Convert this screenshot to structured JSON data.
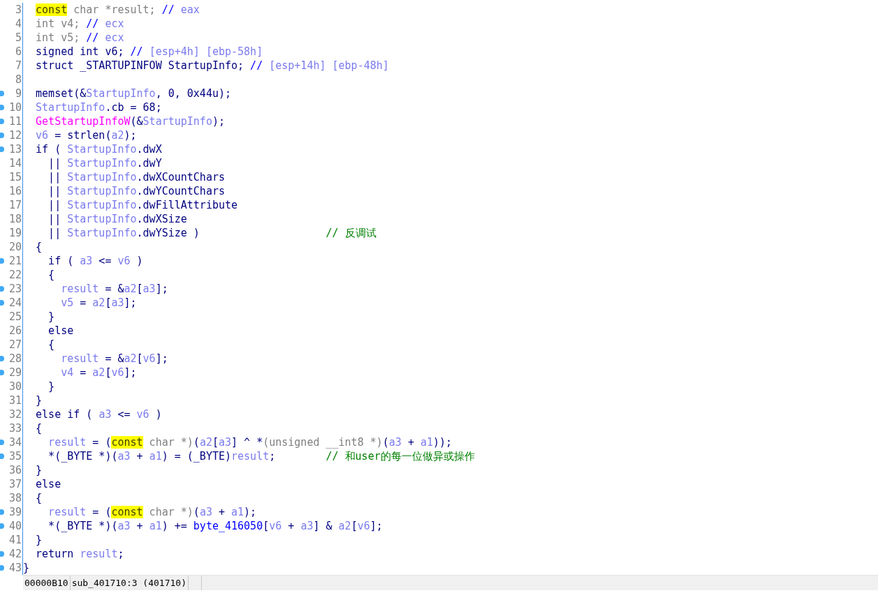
{
  "code_lines": [
    {
      "number": "3",
      "dot": false,
      "tokens": [
        {
          "kind": "highlight",
          "text": "  const"
        },
        {
          "kind": "type",
          "text": " char *result; "
        },
        {
          "kind": "ident",
          "text": "// "
        },
        {
          "kind": "var",
          "text": "eax"
        }
      ]
    },
    {
      "number": "4",
      "dot": false,
      "tokens": [
        {
          "kind": "type",
          "text": "  int v4; "
        },
        {
          "kind": "ident",
          "text": "// "
        },
        {
          "kind": "var",
          "text": "ecx"
        }
      ]
    },
    {
      "number": "5",
      "dot": false,
      "tokens": [
        {
          "kind": "type",
          "text": "  int v5; "
        },
        {
          "kind": "ident",
          "text": "// "
        },
        {
          "kind": "var",
          "text": "ecx"
        }
      ]
    },
    {
      "number": "6",
      "dot": false,
      "tokens": [
        {
          "kind": "plain",
          "text": "  signed int v6; "
        },
        {
          "kind": "ident",
          "text": "// "
        },
        {
          "kind": "var",
          "text": "[esp+4h] [ebp-58h]"
        }
      ]
    },
    {
      "number": "7",
      "dot": false,
      "tokens": [
        {
          "kind": "plain",
          "text": "  struct _STARTUPINFOW StartupInfo; "
        },
        {
          "kind": "ident",
          "text": "// "
        },
        {
          "kind": "var",
          "text": "[esp+14h] [ebp-48h]"
        }
      ]
    },
    {
      "number": "8",
      "dot": false
    },
    {
      "number": "9",
      "dot": true,
      "tokens": [
        {
          "kind": "plain",
          "text": "  memset(&"
        },
        {
          "kind": "var",
          "text": "StartupInfo"
        },
        {
          "kind": "plain",
          "text": ", 0, 0x44u);"
        }
      ]
    },
    {
      "number": "10",
      "dot": true,
      "tokens": [
        {
          "kind": "var",
          "text": "  StartupInfo"
        },
        {
          "kind": "plain",
          "text": ".cb = 68;"
        }
      ]
    },
    {
      "number": "11",
      "dot": true,
      "tokens": [
        {
          "kind": "func",
          "text": "  GetStartupInfoW"
        },
        {
          "kind": "plain",
          "text": "(&"
        },
        {
          "kind": "var",
          "text": "StartupInfo"
        },
        {
          "kind": "plain",
          "text": ");"
        }
      ]
    },
    {
      "number": "12",
      "dot": true,
      "tokens": [
        {
          "kind": "var",
          "text": "  v6"
        },
        {
          "kind": "plain",
          "text": " = strlen("
        },
        {
          "kind": "var",
          "text": "a2"
        },
        {
          "kind": "plain",
          "text": ");"
        }
      ]
    },
    {
      "number": "13",
      "dot": true,
      "tokens": [
        {
          "kind": "plain",
          "text": "  if ( "
        },
        {
          "kind": "var",
          "text": "StartupInfo"
        },
        {
          "kind": "plain",
          "text": ".dwX"
        }
      ]
    },
    {
      "number": "14",
      "dot": false,
      "tokens": [
        {
          "kind": "plain",
          "text": "    || "
        },
        {
          "kind": "var",
          "text": "StartupInfo"
        },
        {
          "kind": "plain",
          "text": ".dwY"
        }
      ]
    },
    {
      "number": "15",
      "dot": false,
      "tokens": [
        {
          "kind": "plain",
          "text": "    || "
        },
        {
          "kind": "var",
          "text": "StartupInfo"
        },
        {
          "kind": "plain",
          "text": ".dwXCountChars"
        }
      ]
    },
    {
      "number": "16",
      "dot": false,
      "tokens": [
        {
          "kind": "plain",
          "text": "    || "
        },
        {
          "kind": "var",
          "text": "StartupInfo"
        },
        {
          "kind": "plain",
          "text": ".dwYCountChars"
        }
      ]
    },
    {
      "number": "17",
      "dot": false,
      "tokens": [
        {
          "kind": "plain",
          "text": "    || "
        },
        {
          "kind": "var",
          "text": "StartupInfo"
        },
        {
          "kind": "plain",
          "text": ".dwFillAttribute"
        }
      ]
    },
    {
      "number": "18",
      "dot": false,
      "tokens": [
        {
          "kind": "plain",
          "text": "    || "
        },
        {
          "kind": "var",
          "text": "StartupInfo"
        },
        {
          "kind": "plain",
          "text": ".dwXSize"
        }
      ]
    },
    {
      "number": "19",
      "dot": false,
      "tokens": [
        {
          "kind": "plain",
          "text": "    || "
        },
        {
          "kind": "var",
          "text": "StartupInfo"
        },
        {
          "kind": "plain",
          "text": ".dwYSize )                    "
        },
        {
          "kind": "comment",
          "text": "// 反调试"
        }
      ]
    },
    {
      "number": "20",
      "dot": false,
      "tokens": [
        {
          "kind": "plain",
          "text": "  {"
        }
      ]
    },
    {
      "number": "21",
      "dot": true,
      "tokens": [
        {
          "kind": "plain",
          "text": "    if ( "
        },
        {
          "kind": "var",
          "text": "a3"
        },
        {
          "kind": "plain",
          "text": " <= "
        },
        {
          "kind": "var",
          "text": "v6"
        },
        {
          "kind": "plain",
          "text": " )"
        }
      ]
    },
    {
      "number": "22",
      "dot": false,
      "tokens": [
        {
          "kind": "plain",
          "text": "    {"
        }
      ]
    },
    {
      "number": "23",
      "dot": true,
      "tokens": [
        {
          "kind": "var",
          "text": "      result"
        },
        {
          "kind": "plain",
          "text": " = &"
        },
        {
          "kind": "var",
          "text": "a2"
        },
        {
          "kind": "plain",
          "text": "["
        },
        {
          "kind": "var",
          "text": "a3"
        },
        {
          "kind": "plain",
          "text": "];"
        }
      ]
    },
    {
      "number": "24",
      "dot": true,
      "tokens": [
        {
          "kind": "var",
          "text": "      v5"
        },
        {
          "kind": "plain",
          "text": " = "
        },
        {
          "kind": "var",
          "text": "a2"
        },
        {
          "kind": "plain",
          "text": "["
        },
        {
          "kind": "var",
          "text": "a3"
        },
        {
          "kind": "plain",
          "text": "];"
        }
      ]
    },
    {
      "number": "25",
      "dot": false,
      "tokens": [
        {
          "kind": "plain",
          "text": "    }"
        }
      ]
    },
    {
      "number": "26",
      "dot": false,
      "tokens": [
        {
          "kind": "plain",
          "text": "    else"
        }
      ]
    },
    {
      "number": "27",
      "dot": false,
      "tokens": [
        {
          "kind": "plain",
          "text": "    {"
        }
      ]
    },
    {
      "number": "28",
      "dot": true,
      "tokens": [
        {
          "kind": "var",
          "text": "      result"
        },
        {
          "kind": "plain",
          "text": " = &"
        },
        {
          "kind": "var",
          "text": "a2"
        },
        {
          "kind": "plain",
          "text": "["
        },
        {
          "kind": "var",
          "text": "v6"
        },
        {
          "kind": "plain",
          "text": "];"
        }
      ]
    },
    {
      "number": "29",
      "dot": true,
      "tokens": [
        {
          "kind": "var",
          "text": "      v4"
        },
        {
          "kind": "plain",
          "text": " = "
        },
        {
          "kind": "var",
          "text": "a2"
        },
        {
          "kind": "plain",
          "text": "["
        },
        {
          "kind": "var",
          "text": "v6"
        },
        {
          "kind": "plain",
          "text": "];"
        }
      ]
    },
    {
      "number": "30",
      "dot": false,
      "tokens": [
        {
          "kind": "plain",
          "text": "    }"
        }
      ]
    },
    {
      "number": "31",
      "dot": false,
      "tokens": [
        {
          "kind": "plain",
          "text": "  }"
        }
      ]
    },
    {
      "number": "32",
      "dot": false,
      "tokens": [
        {
          "kind": "plain",
          "text": "  else if ( "
        },
        {
          "kind": "var",
          "text": "a3"
        },
        {
          "kind": "plain",
          "text": " <= "
        },
        {
          "kind": "var",
          "text": "v6"
        },
        {
          "kind": "plain",
          "text": " )"
        }
      ]
    },
    {
      "number": "33",
      "dot": false,
      "tokens": [
        {
          "kind": "plain",
          "text": "  {"
        }
      ]
    },
    {
      "number": "34",
      "dot": true,
      "tokens": [
        {
          "kind": "var",
          "text": "    result"
        },
        {
          "kind": "plain",
          "text": " = ("
        },
        {
          "kind": "highlight",
          "text": "const"
        },
        {
          "kind": "type",
          "text": " char *)"
        },
        {
          "kind": "plain",
          "text": "("
        },
        {
          "kind": "var",
          "text": "a2"
        },
        {
          "kind": "plain",
          "text": "["
        },
        {
          "kind": "var",
          "text": "a3"
        },
        {
          "kind": "plain",
          "text": "] ^ *"
        },
        {
          "kind": "type",
          "text": "(unsigned __int8 *)"
        },
        {
          "kind": "plain",
          "text": "("
        },
        {
          "kind": "var",
          "text": "a3"
        },
        {
          "kind": "plain",
          "text": " + "
        },
        {
          "kind": "var",
          "text": "a1"
        },
        {
          "kind": "plain",
          "text": "));"
        }
      ]
    },
    {
      "number": "35",
      "dot": true,
      "tokens": [
        {
          "kind": "plain",
          "text": "    *(_BYTE *)("
        },
        {
          "kind": "var",
          "text": "a3"
        },
        {
          "kind": "plain",
          "text": " + "
        },
        {
          "kind": "var",
          "text": "a1"
        },
        {
          "kind": "plain",
          "text": ") = (_BYTE)"
        },
        {
          "kind": "var",
          "text": "result"
        },
        {
          "kind": "plain",
          "text": ";        "
        },
        {
          "kind": "comment",
          "text": "// 和user的每一位做异或操作"
        }
      ]
    },
    {
      "number": "36",
      "dot": false,
      "tokens": [
        {
          "kind": "plain",
          "text": "  }"
        }
      ]
    },
    {
      "number": "37",
      "dot": false,
      "tokens": [
        {
          "kind": "plain",
          "text": "  else"
        }
      ]
    },
    {
      "number": "38",
      "dot": false,
      "tokens": [
        {
          "kind": "plain",
          "text": "  {"
        }
      ]
    },
    {
      "number": "39",
      "dot": true,
      "tokens": [
        {
          "kind": "var",
          "text": "    result"
        },
        {
          "kind": "plain",
          "text": " = ("
        },
        {
          "kind": "highlight",
          "text": "const"
        },
        {
          "kind": "type",
          "text": " char *)"
        },
        {
          "kind": "plain",
          "text": "("
        },
        {
          "kind": "var",
          "text": "a3"
        },
        {
          "kind": "plain",
          "text": " + "
        },
        {
          "kind": "var",
          "text": "a1"
        },
        {
          "kind": "plain",
          "text": ");"
        }
      ]
    },
    {
      "number": "40",
      "dot": true,
      "tokens": [
        {
          "kind": "plain",
          "text": "    *(_BYTE *)("
        },
        {
          "kind": "var",
          "text": "a3"
        },
        {
          "kind": "plain",
          "text": " + "
        },
        {
          "kind": "var",
          "text": "a1"
        },
        {
          "kind": "plain",
          "text": ") += "
        },
        {
          "kind": "ident",
          "text": "byte_416050"
        },
        {
          "kind": "plain",
          "text": "["
        },
        {
          "kind": "var",
          "text": "v6"
        },
        {
          "kind": "plain",
          "text": " + "
        },
        {
          "kind": "var",
          "text": "a3"
        },
        {
          "kind": "plain",
          "text": "] & "
        },
        {
          "kind": "var",
          "text": "a2"
        },
        {
          "kind": "plain",
          "text": "["
        },
        {
          "kind": "var",
          "text": "v6"
        },
        {
          "kind": "plain",
          "text": "];"
        }
      ]
    },
    {
      "number": "41",
      "dot": false,
      "tokens": [
        {
          "kind": "plain",
          "text": "  }"
        }
      ]
    },
    {
      "number": "42",
      "dot": true,
      "tokens": [
        {
          "kind": "plain",
          "text": "  return "
        },
        {
          "kind": "var",
          "text": "result"
        },
        {
          "kind": "plain",
          "text": ";"
        }
      ]
    },
    {
      "number": "43",
      "dot": true,
      "tokens": [
        {
          "kind": "plain",
          "text": "}"
        }
      ]
    }
  ],
  "status_bar": {
    "address": "00000B10",
    "location": "sub_401710:3 (401710)"
  }
}
